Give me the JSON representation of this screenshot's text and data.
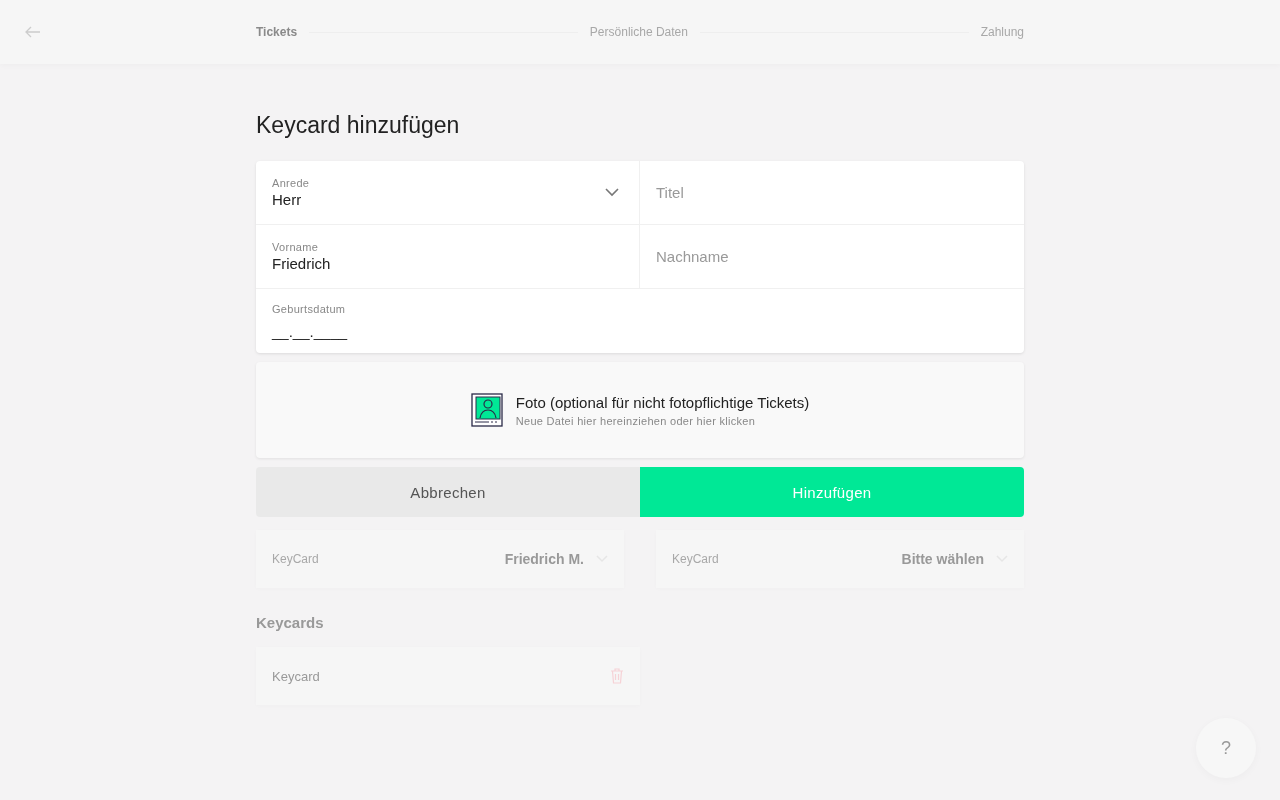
{
  "header": {
    "steps": [
      {
        "label": "Tickets",
        "selected": true
      },
      {
        "label": "Persönliche Daten",
        "selected": false
      },
      {
        "label": "Zahlung",
        "selected": false
      }
    ]
  },
  "background": {
    "selects": [
      {
        "label": "KeyCard",
        "value": "Friedrich M."
      },
      {
        "label": "KeyCard",
        "value": "Bitte wählen"
      }
    ],
    "keycards_heading": "Keycards",
    "keycards": [
      {
        "label": "Keycard"
      }
    ]
  },
  "help_button": "?",
  "modal": {
    "title": "Keycard hinzufügen",
    "fields": [
      {
        "kind": "select",
        "label": "Anrede",
        "value": "Herr"
      },
      {
        "kind": "text",
        "placeholder": "Titel"
      },
      {
        "kind": "text",
        "label": "Vorname",
        "value": "Friedrich"
      },
      {
        "kind": "text",
        "placeholder": "Nachname"
      },
      {
        "kind": "date",
        "label": "Geburtsdatum",
        "value": "__.__.____"
      }
    ],
    "photo": {
      "title": "Foto (optional für nicht fotopflichtige Tickets)",
      "hint": "Neue Datei hier hereinziehen oder hier klicken"
    },
    "buttons": [
      {
        "label": "Abbrechen",
        "kind": "secondary"
      },
      {
        "label": "Hinzufügen",
        "kind": "primary"
      }
    ]
  }
}
